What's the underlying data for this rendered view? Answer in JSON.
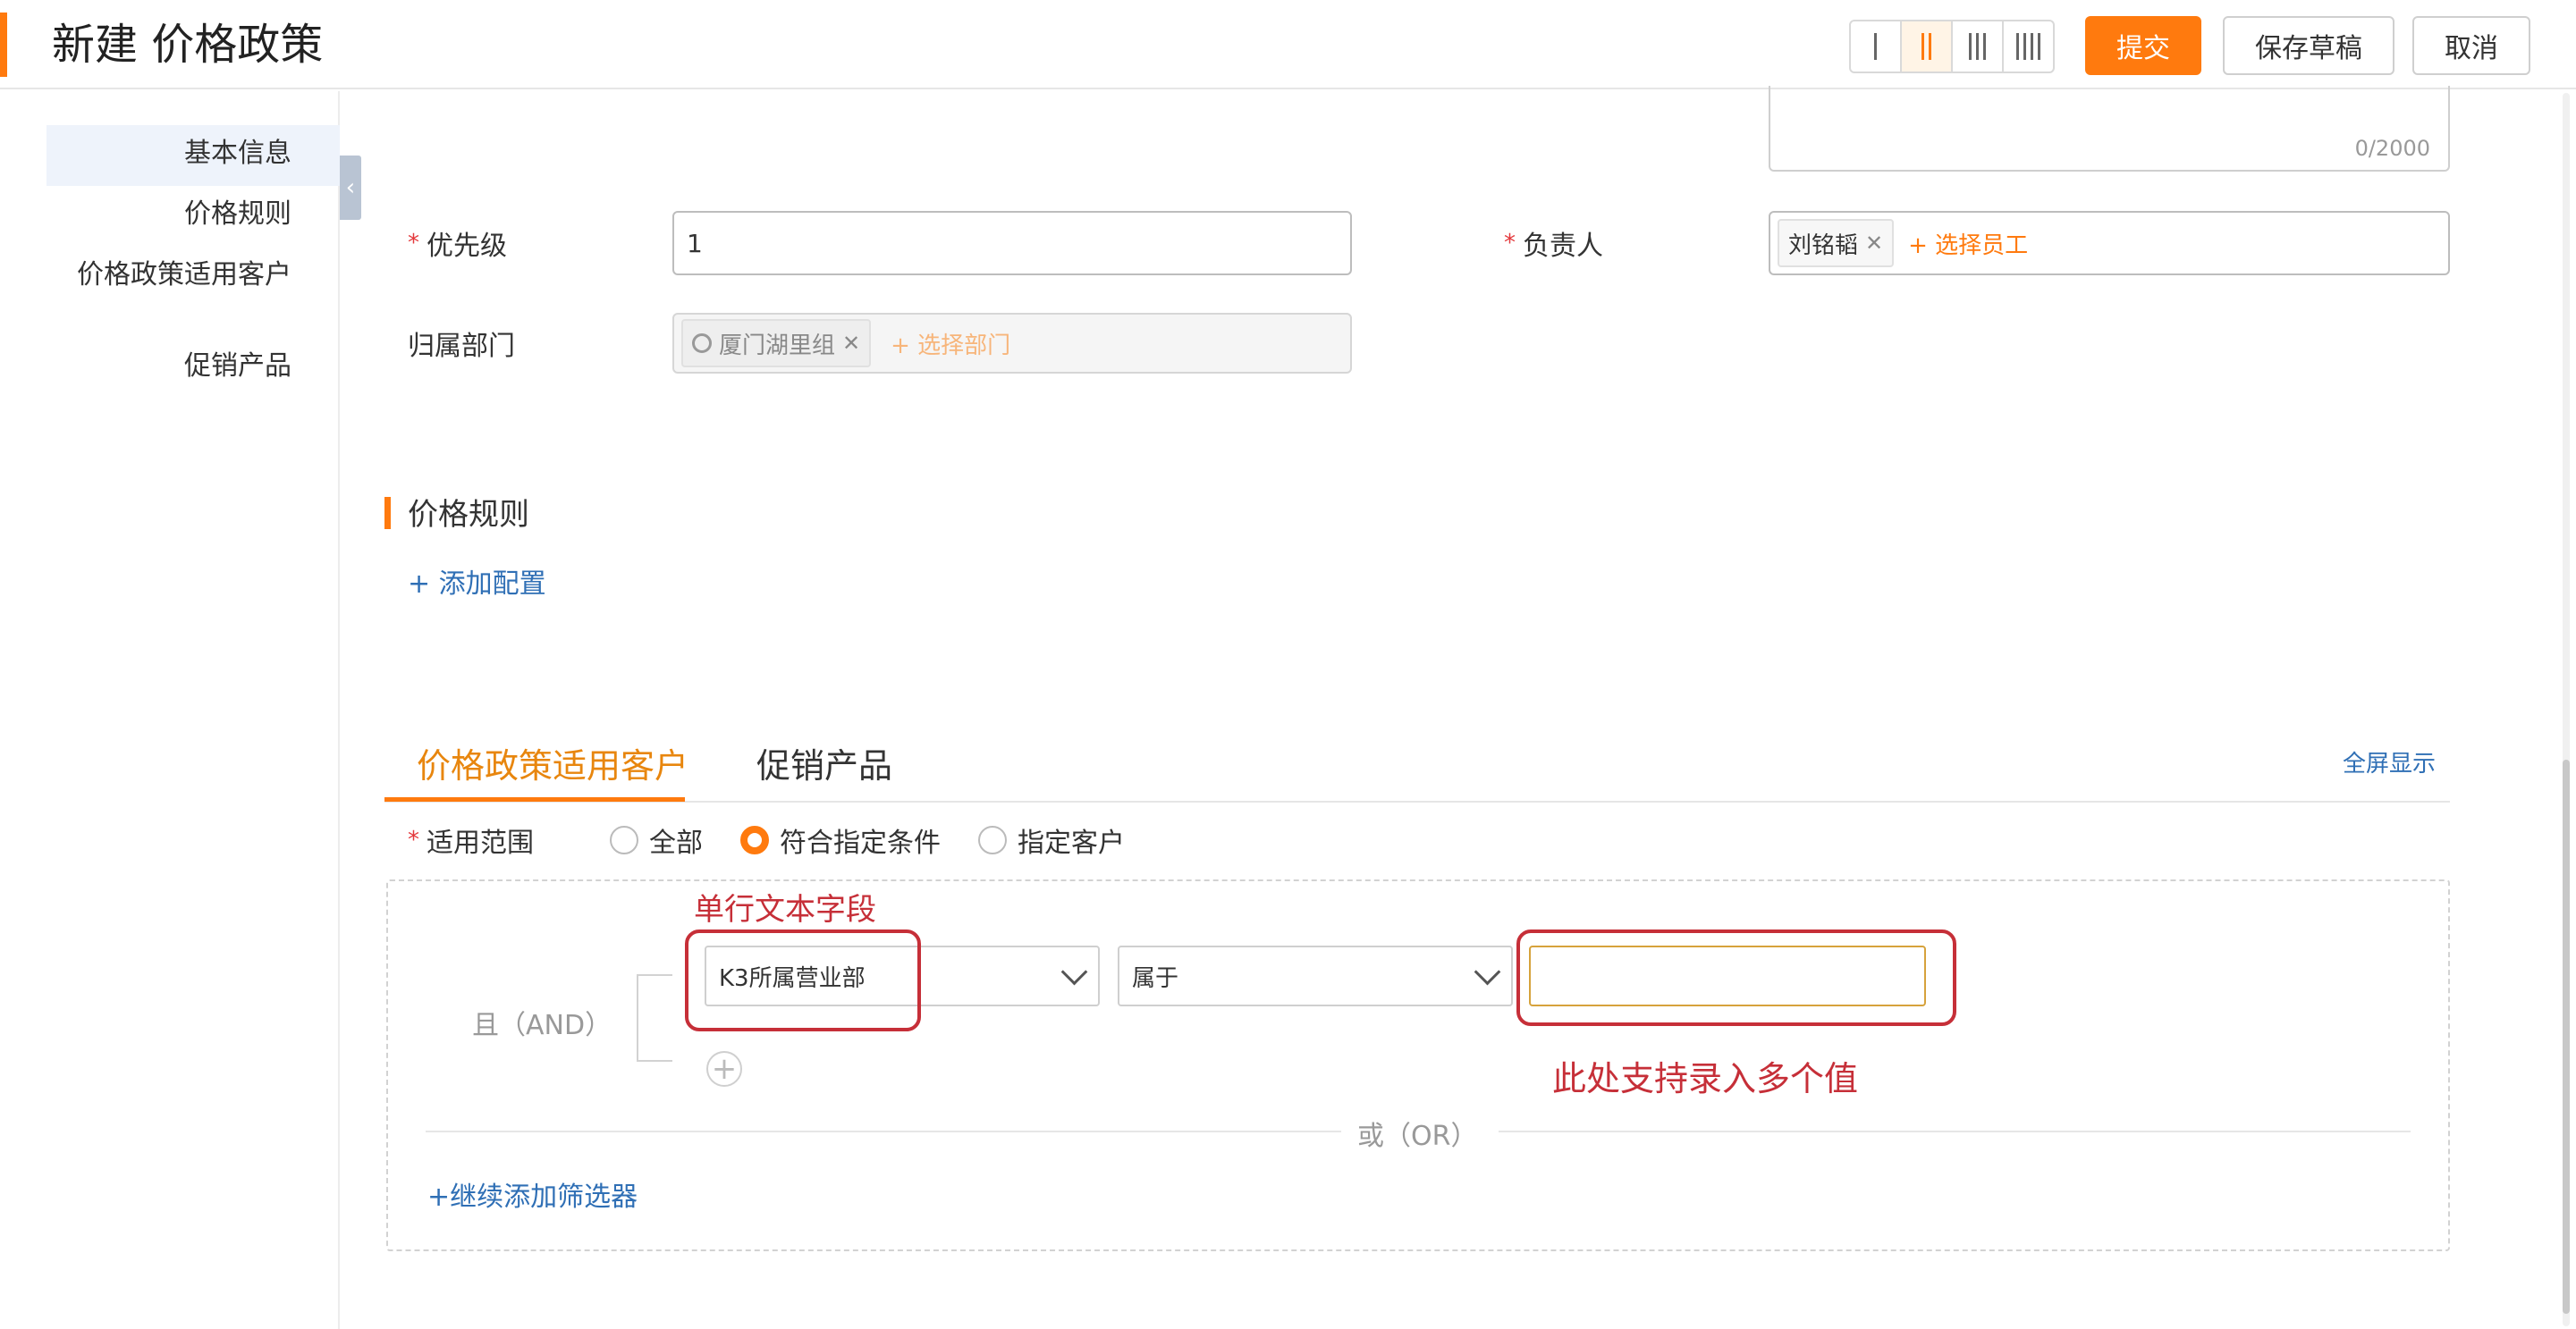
{
  "header": {
    "title": "新建 价格政策",
    "buttons": {
      "submit": "提交",
      "save_draft": "保存草稿",
      "cancel": "取消"
    },
    "accent_color": "#ff7a0e"
  },
  "sidenav": {
    "items": [
      {
        "label": "基本信息",
        "active": true
      },
      {
        "label": "价格规则"
      },
      {
        "label": "价格政策适用客户"
      },
      {
        "label": "促销产品"
      }
    ],
    "collapse_icon": "chevron-left-icon"
  },
  "form": {
    "textarea_counter": "0/2000",
    "priority": {
      "label": "优先级",
      "value": "1"
    },
    "owner": {
      "label": "负责人",
      "tag": "刘铭韬",
      "add_label": "+ 选择员工"
    },
    "department": {
      "label": "归属部门",
      "tag": "厦门湖里组",
      "add_label": "+ 选择部门"
    }
  },
  "price_rules": {
    "title": "价格规则",
    "add_label": "+ 添加配置"
  },
  "tabs": {
    "items": [
      "价格政策适用客户",
      "促销产品"
    ],
    "active": 0,
    "fullscreen_label": "全屏显示"
  },
  "scope": {
    "label": "适用范围",
    "options": [
      "全部",
      "符合指定条件",
      "指定客户"
    ],
    "selected": 1
  },
  "filter": {
    "and_label": "且（AND）",
    "field": "K3所属营业部",
    "operator": "属于",
    "value": "",
    "or_label": "或（OR）",
    "add_filter_label": "+继续添加筛选器"
  },
  "annotations": {
    "field_note": "单行文本字段",
    "value_note": "此处支持录入多个值",
    "color": "#c62f38"
  }
}
